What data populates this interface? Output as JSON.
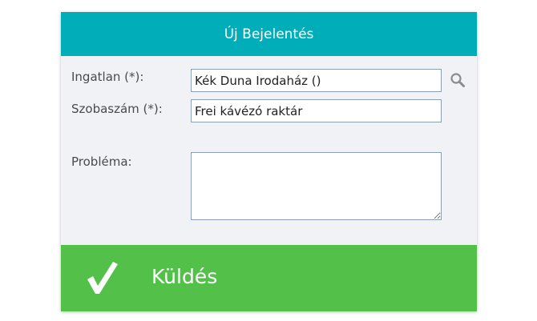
{
  "header": {
    "title": "Új Bejelentés"
  },
  "form": {
    "property_label": "Ingatlan (*):",
    "property_value": "Kék Duna Irodaház ()",
    "room_label": "Szobaszám (*):",
    "room_value": "Frei kávézó raktár",
    "problem_label": "Probléma:",
    "problem_value": ""
  },
  "submit": {
    "label": "Küldés"
  },
  "icons": {
    "search": "search-icon",
    "check": "check-icon"
  },
  "colors": {
    "header_bg": "#00adb9",
    "card_bg": "#f1f2f6",
    "submit_bg": "#53c04a",
    "field_border": "#8e9fb5"
  }
}
